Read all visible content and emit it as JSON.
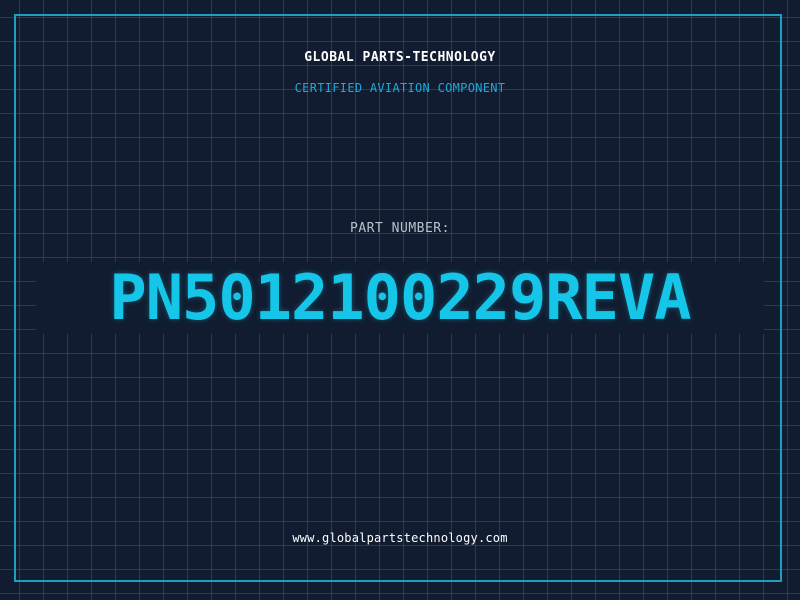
{
  "header": {
    "brand": "GLOBAL PARTS-TECHNOLOGY",
    "tagline": "CERTIFIED AVIATION COMPONENT"
  },
  "part": {
    "label": "PART NUMBER:",
    "number": "PN5012100229REVA"
  },
  "footer": {
    "url": "www.globalpartstechnology.com"
  },
  "colors": {
    "background": "#111c30",
    "grid": "#266078",
    "frame": "#1e9fc0",
    "accent": "#16c6e8",
    "tagline": "#1fa8d4",
    "text": "#ffffff",
    "label": "#b8c2cc"
  }
}
